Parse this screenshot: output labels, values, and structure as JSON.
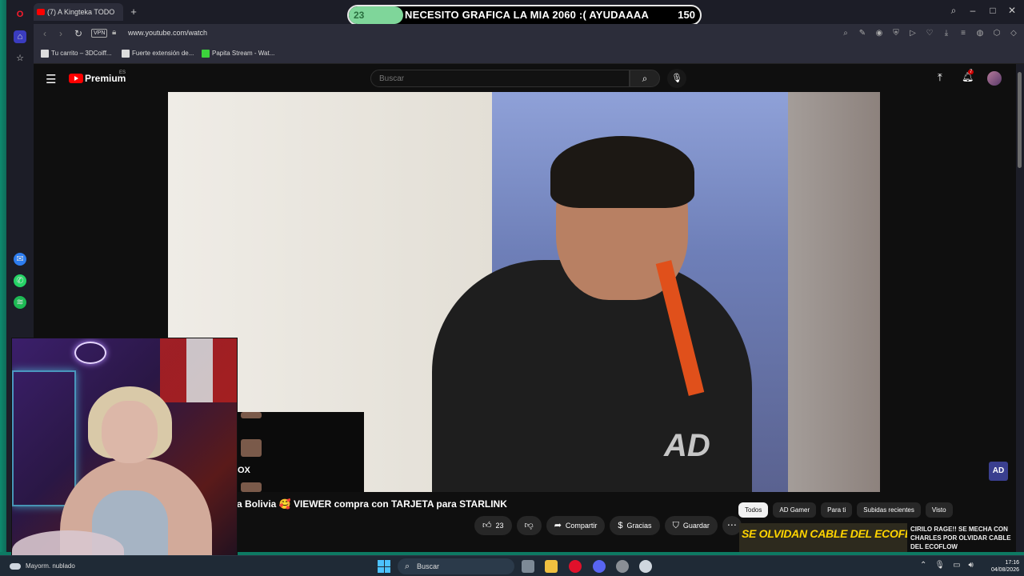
{
  "browser": {
    "tab_title": "(7) A Kingteka TODO",
    "url": "www.youtube.com/watch",
    "vpn_label": "VPN",
    "bookmarks": [
      {
        "label": "Tu carrito – 3DCoiff..."
      },
      {
        "label": "Fuerte extensión de..."
      },
      {
        "label": "Papita Stream - Wat..."
      }
    ]
  },
  "alert": {
    "current": "23",
    "message": "NECESITO GRAFICA LA MIA 2060 :( AYUDAAAA",
    "goal": "150",
    "progress_fraction": 0.153
  },
  "youtube": {
    "brand": "Premium",
    "region": "ES",
    "search_placeholder": "Buscar",
    "notification_count": "7",
    "video_title_visible": "a Bolivia 🥰 VIEWER compra con TARJETA para STARLINK",
    "like_count": "23",
    "share_label": "Compartir",
    "thanks_label": "Gracias",
    "save_label": "Guardar",
    "more_label": "⋯",
    "watermark": "AD",
    "corner_logo": "AD",
    "filters": [
      "Todos",
      "AD Gamer",
      "Para ti",
      "Subidas recientes",
      "Visto"
    ],
    "recommendation": {
      "thumbnail_text": "SE OLVIDAN CABLE DEL ECOFLOW",
      "title": "CIRILO RAGE!! SE MECHA CON CHARLES POR OLVIDAR CABLE DEL ECOFLOW"
    }
  },
  "chat": {
    "visible_text": "OX"
  },
  "taskbar": {
    "weather": "Mayorm. nublado",
    "search_label": "Buscar",
    "time": "17:16",
    "date": "04/08/2026"
  },
  "colors": {
    "accent_red": "#ff0000",
    "alert_green": "#7fd69a",
    "thumbnail_yellow": "#ffd400",
    "frame_teal": "#0e8a6e"
  }
}
